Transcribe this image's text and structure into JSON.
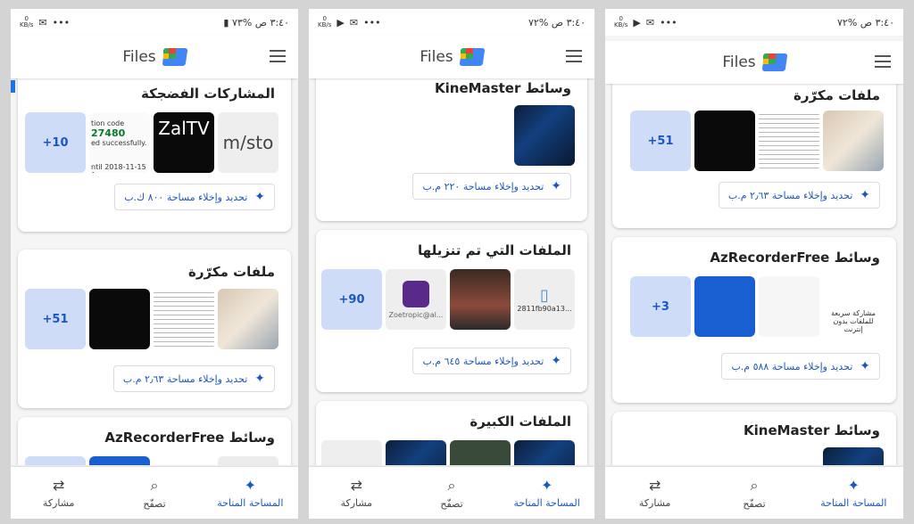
{
  "status": {
    "time": "٣:٤٠ ص",
    "battery": "%٧٣",
    "battery2": "%٧٢",
    "speed_value": "0",
    "speed_unit": "KB/s"
  },
  "appbar": {
    "title": "Files"
  },
  "nav": {
    "space": "المساحة المتاحة",
    "browse": "تصفّح",
    "share": "مشاركة"
  },
  "cards": {
    "memes": "المشاركات الفضجكة",
    "dupes": "ملفات مكرّرة",
    "az": "AzRecorderFree",
    "az_prefix": "وسائط",
    "km": "KineMaster",
    "km_prefix": "وسائط",
    "downloads": "الملفات التي تم تنزيلها",
    "large": "الملفات الكبيرة"
  },
  "buttons": {
    "p1_memes": "تحديد وإخلاء مساحة ٨٠٠ ك.ب",
    "p1_dupes": "تحديد وإخلاء مساحة ٢٫٦٣ م.ب",
    "p2_km": "تحديد وإخلاء مساحة ٢٢٠ م.ب",
    "p2_dl": "تحديد وإخلاء مساحة ٦٤٥ م.ب",
    "p3_dupes": "تحديد وإخلاء مساحة ٢٫٦٣ م.ب",
    "p3_az": "تحديد وإخلاء مساحة ٥٨٨ م.ب"
  },
  "thumbs": {
    "memes_plus": "+10",
    "memes_code1": "tion code",
    "memes_code2": "27480",
    "memes_code3": "ed successfully.",
    "memes_date": "ntil 2018-11-15 1",
    "memes_zal": "ZalTV",
    "memes_url": "m/sto",
    "dupes_plus": "+51",
    "dl_plus": "+90",
    "dl_zoe": "Zoetropic@al...",
    "dl_file": "2811fb90a13...",
    "az_plus": "+3",
    "az_txt": "مشاركة سريعة للملفات بدون إنترنت"
  },
  "colors": {
    "accent": "#1a56c4",
    "plus_bg": "#cfdcf7"
  }
}
